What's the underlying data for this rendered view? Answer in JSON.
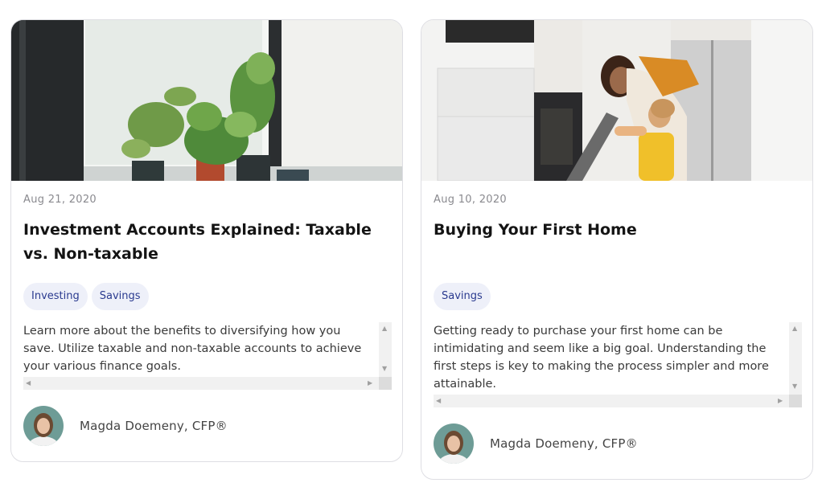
{
  "cards": [
    {
      "date": "Aug 21, 2020",
      "title": "Investment Accounts Explained: Taxable vs. Non-taxable",
      "tags": [
        "Investing",
        "Savings"
      ],
      "excerpt": "Learn more about the benefits to diversifying how you save. Utilize taxable and non-taxable accounts to achieve your various finance goals.",
      "author": "Magda Doemeny, CFP®",
      "image": "plants-on-windowsill-photo"
    },
    {
      "date": "Aug 10, 2020",
      "title": "Buying Your First Home",
      "tags": [
        "Savings"
      ],
      "excerpt": "Getting ready to purchase your first home can be intimidating and seem like a big goal. Understanding the first steps is key to making the process simpler and more attainable.",
      "author": "Magda Doemeny, CFP®",
      "image": "mother-and-child-baking-in-kitchen-photo"
    }
  ],
  "colors": {
    "tag_bg": "#eef0f9",
    "tag_text": "#2a3a8f",
    "card_border": "#dedee3"
  }
}
